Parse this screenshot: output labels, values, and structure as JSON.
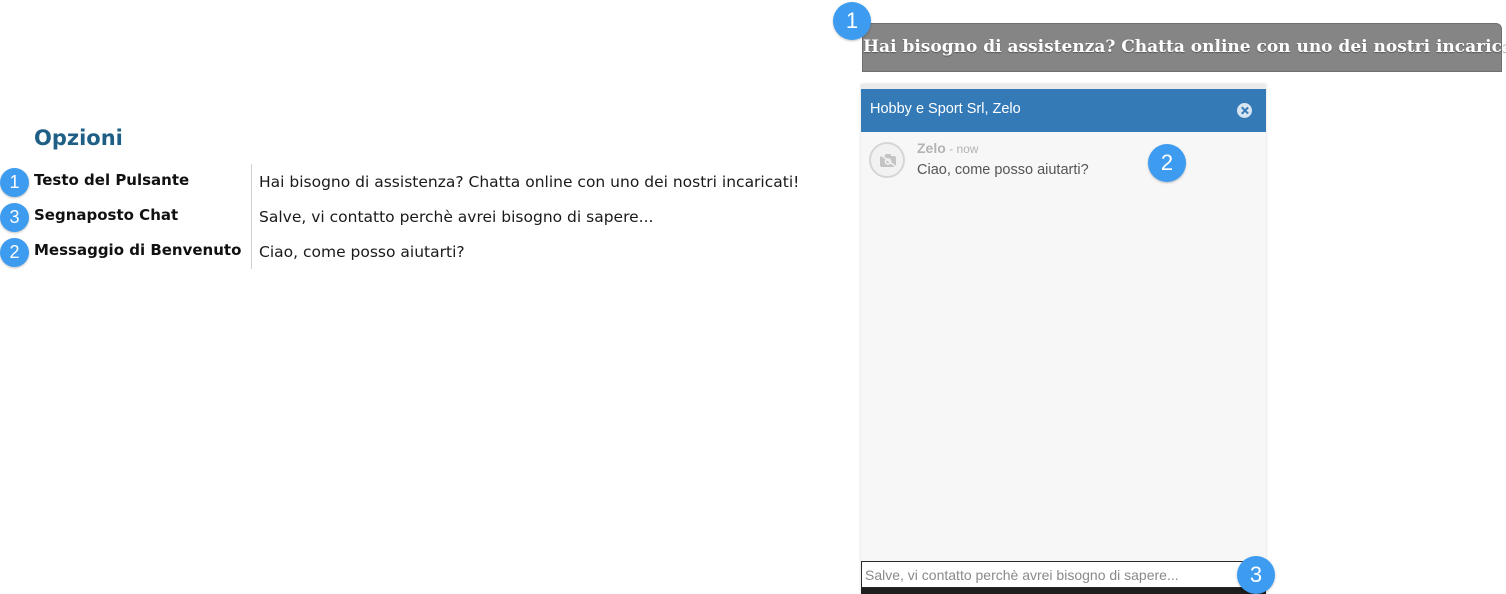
{
  "options": {
    "title": "Opzioni",
    "rows": [
      {
        "badge": "1",
        "label": "Testo del Pulsante",
        "value": "Hai bisogno di assistenza? Chatta online con uno dei nostri incaricati!"
      },
      {
        "badge": "3",
        "label": "Segnaposto Chat",
        "value": "Salve, vi contatto perchè avrei bisogno di sapere..."
      },
      {
        "badge": "2",
        "label": "Messaggio di Benvenuto",
        "value": "Ciao, come posso aiutarti?"
      }
    ]
  },
  "chat_button": {
    "badge": "1",
    "label": "Hai bisogno di assistenza? Chatta online con uno dei nostri incaricati!"
  },
  "chat_window": {
    "title": "Hobby e Sport Srl, Zelo",
    "close_icon": "close-icon",
    "message": {
      "author": "Zelo",
      "separator": " - ",
      "time": "now",
      "text": "Ciao, come posso aiutarti?",
      "avatar_icon": "camera-icon",
      "badge": "2"
    },
    "input": {
      "placeholder": "Salve, vi contatto perchè avrei bisogno di sapere...",
      "badge": "3"
    }
  },
  "colors": {
    "accent": "#3d9cf0",
    "header": "#337ab7",
    "button": "#858585",
    "options_title": "#1f5f86"
  }
}
